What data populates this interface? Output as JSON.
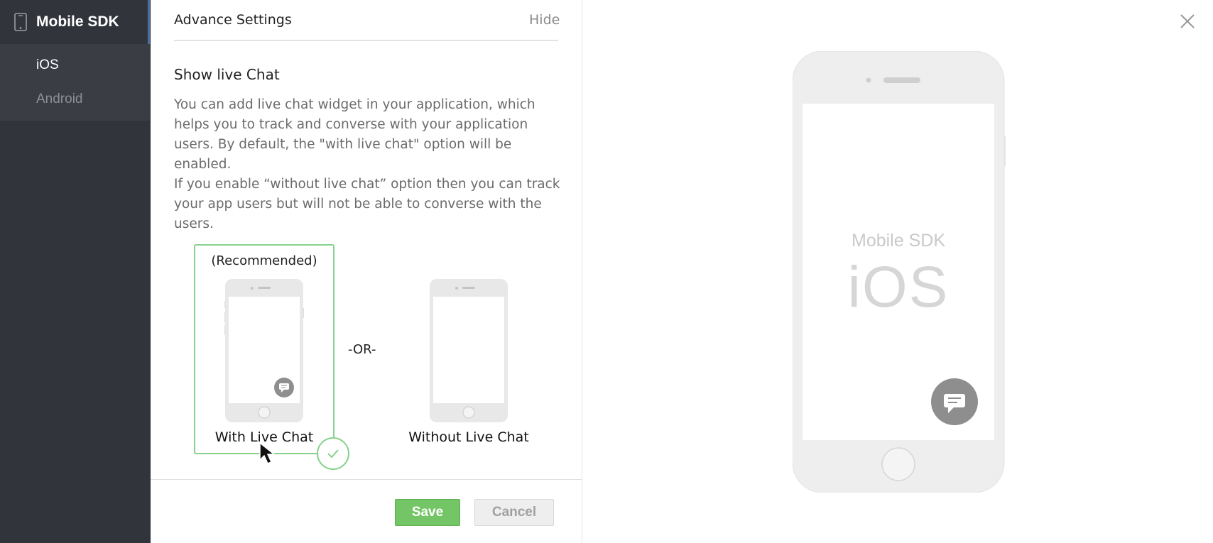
{
  "sidebar": {
    "title": "Mobile SDK",
    "items": [
      {
        "label": "iOS",
        "active": true
      },
      {
        "label": "Android",
        "active": false
      }
    ]
  },
  "panel": {
    "header_title": "Advance Settings",
    "hide_label": "Hide",
    "section_title": "Show live Chat",
    "description_lines": [
      "You can add live chat widget in your application, which",
      "helps you to track and converse with your application",
      "users. By default, the \"with live chat\" option will be enabled.",
      "If you enable “without live chat” option then you can track",
      "your app users but will not be able to converse with the",
      "users."
    ],
    "options": {
      "recommended": "(Recommended)",
      "with_label": "With Live Chat",
      "or_label": "-OR-",
      "without_label": "Without Live Chat",
      "selected": "with"
    },
    "save_label": "Save",
    "cancel_label": "Cancel"
  },
  "preview": {
    "brand": "Mobile SDK",
    "platform": "iOS"
  },
  "colors": {
    "sidebar_bg": "#31343b",
    "accent_green": "#74c565",
    "selected_border": "#86d28c"
  }
}
